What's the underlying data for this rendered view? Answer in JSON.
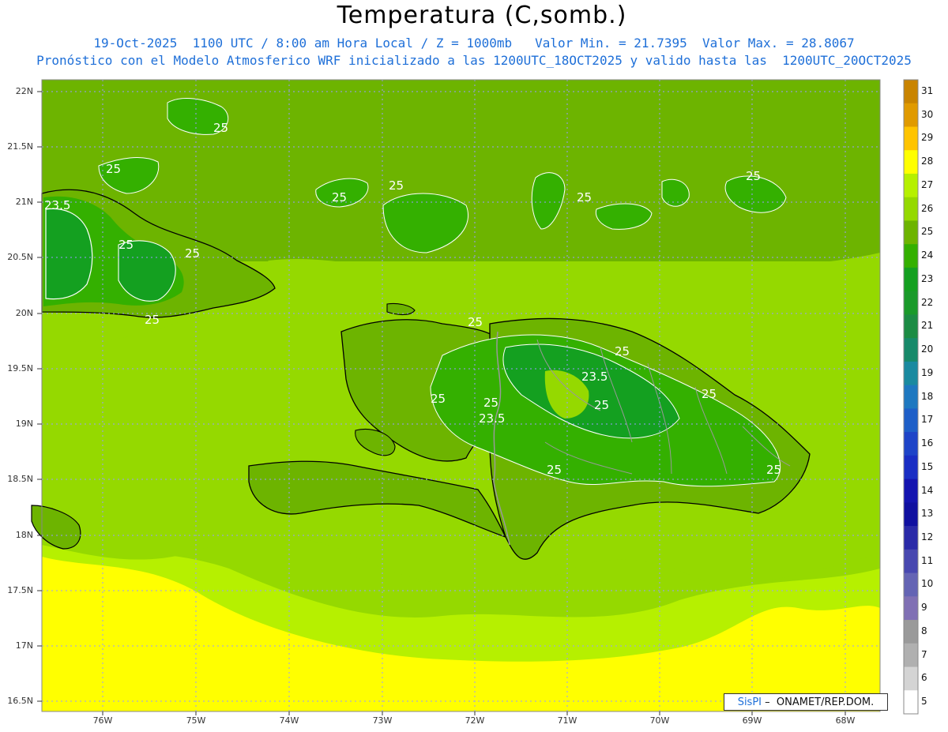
{
  "header": {
    "title": "Temperatura (C,somb.)",
    "line1": "19-Oct-2025  1100 UTC / 8:00 am Hora Local / Z = 1000mb   Valor Min. = 21.7395  Valor Max. = 28.8067",
    "line2": "Pronóstico con el Modelo Atmosferico WRF inicializado a las 1200UTC_18OCT2025 y valido hasta las  1200UTC_20OCT2025"
  },
  "axes": {
    "lat_ticks": [
      "22N",
      "21.5N",
      "21N",
      "20.5N",
      "20N",
      "19.5N",
      "19N",
      "18.5N",
      "18N",
      "17.5N",
      "17N",
      "16.5N"
    ],
    "lon_ticks": [
      "76W",
      "75W",
      "74W",
      "73W",
      "72W",
      "71W",
      "70W",
      "69W",
      "68W"
    ]
  },
  "colorbar": {
    "labels": [
      "31",
      "30",
      "29",
      "28",
      "27",
      "26",
      "25",
      "24",
      "23",
      "22",
      "21",
      "20",
      "19",
      "18",
      "17",
      "16",
      "15",
      "14",
      "13",
      "12",
      "11",
      "10",
      "9",
      "8",
      "7",
      "6",
      "5"
    ],
    "colors": [
      "#c98400",
      "#e09a00",
      "#ffc400",
      "#ffff00",
      "#b6f000",
      "#95d900",
      "#6db400",
      "#34b000",
      "#14a020",
      "#1a9a2a",
      "#1c8c44",
      "#178a6a",
      "#1a8aa0",
      "#1e78c0",
      "#1e5fc8",
      "#1e44c8",
      "#1a2ec4",
      "#1414b0",
      "#1010a0",
      "#2a2aa8",
      "#4848b0",
      "#6464b4",
      "#8070b4",
      "#9a9a9a",
      "#b0b0b0",
      "#d4d4d4",
      "#ffffff"
    ]
  },
  "contour_labels": {
    "c1": "25",
    "c2": "25",
    "c3": "23.5",
    "c4": "25",
    "c5": "25",
    "c6": "25",
    "c7": "25",
    "c8": "25",
    "c9": "25",
    "c10": "25",
    "c11": "25",
    "c12": "25",
    "c13": "23.5",
    "c14": "25",
    "c15": "25",
    "c16": "23.5",
    "c17": "25",
    "c18": "25",
    "c19": "25",
    "c20": "25",
    "c21": "25"
  },
  "credit": {
    "brand": "SisPI",
    "text": " –  ONAMET/REP.DOM."
  }
}
